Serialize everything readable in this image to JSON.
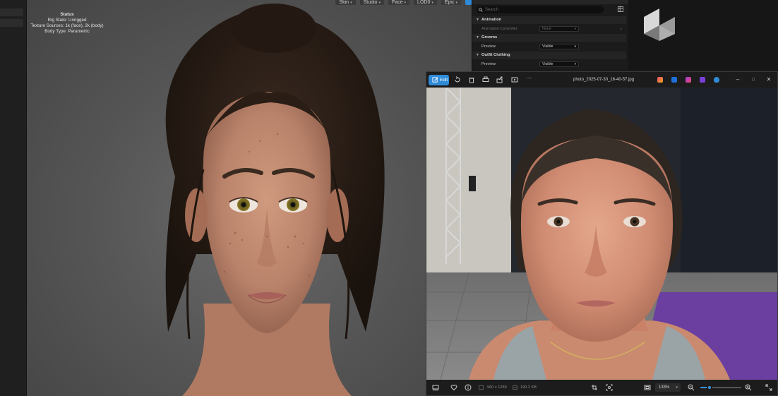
{
  "viewport": {
    "toolbar": [
      {
        "label": "Skin"
      },
      {
        "label": "Studio"
      },
      {
        "label": "Face"
      },
      {
        "label": "LOD0"
      },
      {
        "label": "Epic"
      }
    ],
    "status": {
      "title": "Status",
      "rig_state": "Rig State: Unrigged",
      "texture_sources": "Texture Sources: 1k (face), 2k (body)",
      "body_type": "Body Type: Parametric"
    }
  },
  "details_panel": {
    "search_placeholder": "Search",
    "sections": [
      {
        "title": "Animation",
        "rows": [
          {
            "label": "Animation Controller",
            "value": "None",
            "disabled": true
          }
        ]
      },
      {
        "title": "Grooms",
        "rows": [
          {
            "label": "Preview",
            "value": "Visible",
            "disabled": false
          }
        ]
      },
      {
        "title": "Outfit Clothing",
        "rows": [
          {
            "label": "Preview",
            "value": "Visible",
            "disabled": false
          }
        ]
      }
    ]
  },
  "photos_window": {
    "edit_label": "Edit",
    "more_label": "···",
    "filename": "photo_2025-07-30_16-40-57.jpg",
    "window_controls": {
      "minimize": "–",
      "maximize": "□",
      "close": "✕"
    },
    "status": {
      "dimensions": "960 x 1280",
      "file_size": "190.2 KB",
      "zoom": "133%",
      "zoom_fraction": 0.22
    }
  },
  "colors": {
    "accent": "#2f8bd8",
    "viewport_bg": "#5a5a5a",
    "panel_bg": "#1b1b1b",
    "carpet": "#6b3fa0"
  }
}
